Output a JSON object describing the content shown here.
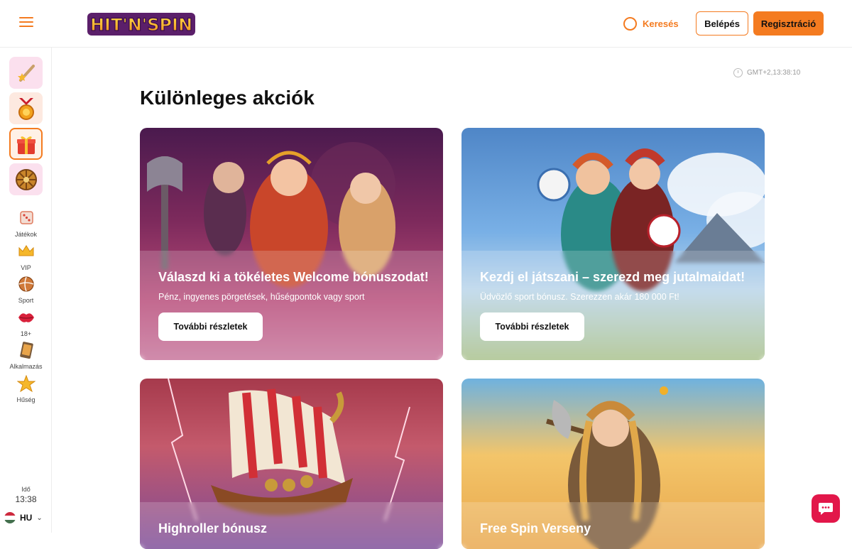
{
  "header": {
    "logo_text": "HIT'N'SPIN",
    "search_label": "Keresés",
    "login_label": "Belépés",
    "register_label": "Regisztráció"
  },
  "sidebar": {
    "promo_tiles": [
      {
        "icon": "sword-star-icon"
      },
      {
        "icon": "medal-icon"
      },
      {
        "icon": "gift-icon"
      },
      {
        "icon": "wheel-icon"
      }
    ],
    "nav_items": [
      {
        "label": "Játékok",
        "icon": "dice-icon"
      },
      {
        "label": "VIP",
        "icon": "crown-icon"
      },
      {
        "label": "Sport",
        "icon": "ball-icon"
      },
      {
        "label": "18+",
        "icon": "lips-icon"
      },
      {
        "label": "Alkalmazás",
        "icon": "tablet-icon"
      },
      {
        "label": "Hűség",
        "icon": "star-icon"
      }
    ],
    "time_label": "Idő",
    "time_value": "13:38",
    "language": "HU"
  },
  "main": {
    "timezone": "GMT+2,13:38:10",
    "title": "Különleges akciók",
    "cards": [
      {
        "title": "Válaszd ki a tökéletes Welcome bónuszodat!",
        "subtitle": "Pénz, ingyenes pörgetések, hűségpontok vagy sport",
        "button": "További részletek"
      },
      {
        "title": "Kezdj el játszani – szerezd meg jutalmaidat!",
        "subtitle": "Üdvözlő sport bónusz. Szerezzen akár  180 000 Ft!",
        "button": "További részletek"
      },
      {
        "title": "Highroller bónusz"
      },
      {
        "title": "Free Spin Verseny"
      }
    ]
  },
  "colors": {
    "accent": "#f47b20",
    "chat": "#e2174a"
  }
}
